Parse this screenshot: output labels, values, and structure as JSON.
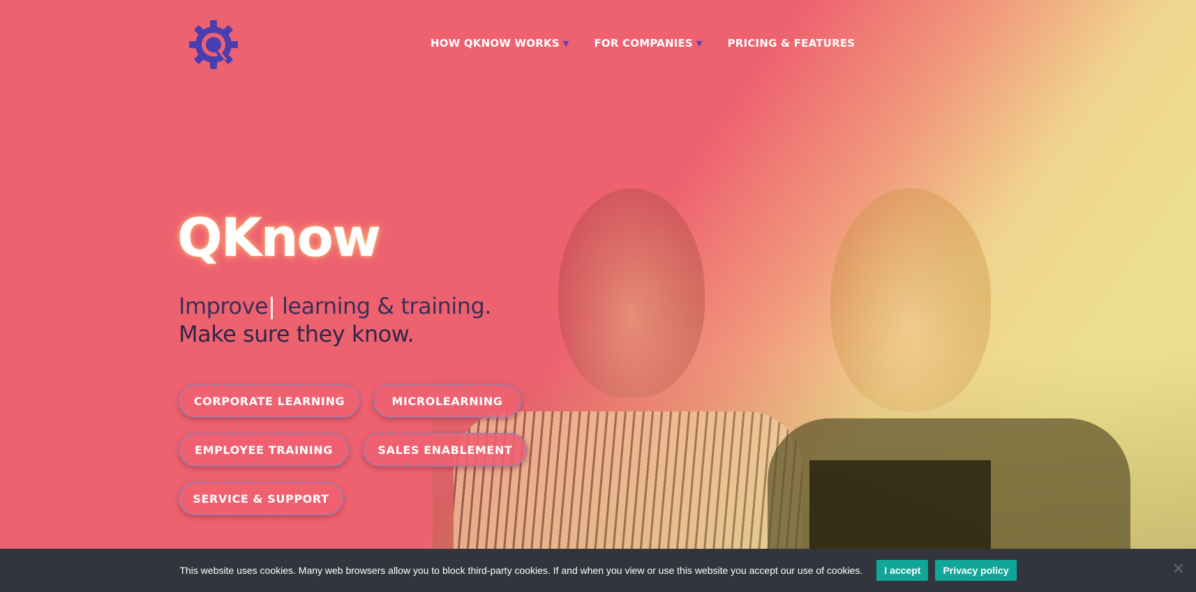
{
  "brand": {
    "name": "QKnow",
    "logo_icon": "gear-q-logo-icon",
    "logo_color": "#4a3db0"
  },
  "nav": {
    "items": [
      {
        "label": "HOW QKNOW WORKS",
        "has_dropdown": true
      },
      {
        "label": "FOR COMPANIES",
        "has_dropdown": true
      },
      {
        "label": "PRICING & FEATURES",
        "has_dropdown": false
      }
    ],
    "dropdown_icon": "chevron-down-icon"
  },
  "hero": {
    "title": "QKnow",
    "tagline_word": "Improve",
    "tagline_cursor": "|",
    "tagline_rest": " learning & training.",
    "tagline_line2": "Make sure they know."
  },
  "buttons": [
    {
      "label": "CORPORATE LEARNING"
    },
    {
      "label": "MICROLEARNING"
    },
    {
      "label": "EMPLOYEE TRAINING"
    },
    {
      "label": "SALES ENABLEMENT"
    },
    {
      "label": "SERVICE & SUPPORT"
    }
  ],
  "cookie": {
    "text": "This website uses cookies. Many web browsers allow you to block third-party cookies. If and when you view or use this website you accept our use of cookies.",
    "accept_label": "I accept",
    "policy_label": "Privacy policy",
    "close_label": "×"
  },
  "colors": {
    "primary_red": "#ee6270",
    "accent_teal": "#10a79a",
    "cookie_bg": "#32353c",
    "nav_chevron": "#5a3fb0"
  }
}
